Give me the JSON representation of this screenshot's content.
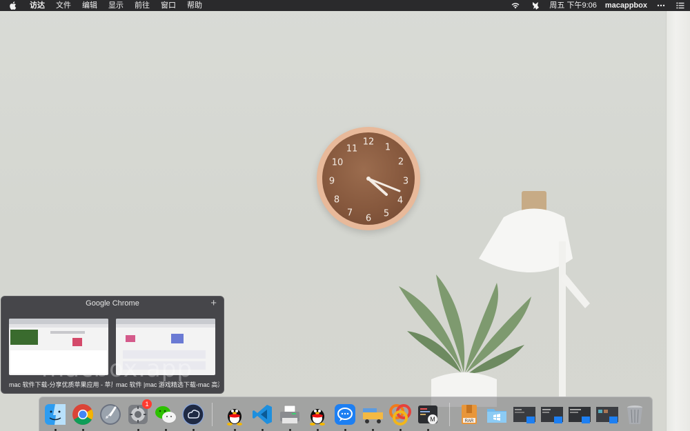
{
  "menubar": {
    "app_name": "访达",
    "items": [
      "文件",
      "编辑",
      "显示",
      "前往",
      "窗口",
      "帮助"
    ],
    "clock": "周五 下午9:06",
    "user": "macappbox"
  },
  "clock_numbers": [
    "12",
    "1",
    "2",
    "3",
    "4",
    "5",
    "6",
    "7",
    "8",
    "9",
    "10",
    "11"
  ],
  "app_popover": {
    "title": "Google Chrome",
    "add_label": "+",
    "windows": [
      {
        "caption": "mac 软件下载-分享优质苹果应用 - 苹果..."
      },
      {
        "caption": "mac 软件 |mac 游戏精选下载-mac 高清..."
      }
    ]
  },
  "watermark": "macbox.app",
  "dock": {
    "badge_count": "1",
    "accent": "#ff3b30"
  }
}
